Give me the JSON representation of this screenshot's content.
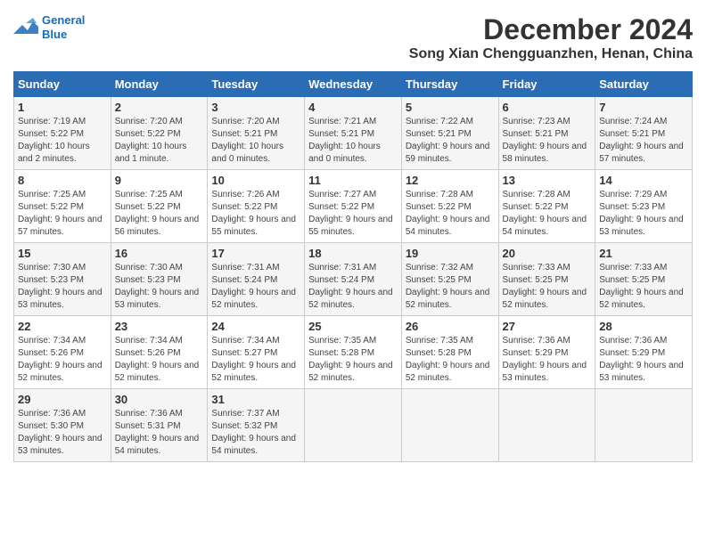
{
  "logo": {
    "line1": "General",
    "line2": "Blue"
  },
  "title": "December 2024",
  "subtitle": "Song Xian Chengguanzhen, Henan, China",
  "weekdays": [
    "Sunday",
    "Monday",
    "Tuesday",
    "Wednesday",
    "Thursday",
    "Friday",
    "Saturday"
  ],
  "weeks": [
    [
      {
        "day": "1",
        "rise": "Sunrise: 7:19 AM",
        "set": "Sunset: 5:22 PM",
        "daylight": "Daylight: 10 hours and 2 minutes."
      },
      {
        "day": "2",
        "rise": "Sunrise: 7:20 AM",
        "set": "Sunset: 5:22 PM",
        "daylight": "Daylight: 10 hours and 1 minute."
      },
      {
        "day": "3",
        "rise": "Sunrise: 7:20 AM",
        "set": "Sunset: 5:21 PM",
        "daylight": "Daylight: 10 hours and 0 minutes."
      },
      {
        "day": "4",
        "rise": "Sunrise: 7:21 AM",
        "set": "Sunset: 5:21 PM",
        "daylight": "Daylight: 10 hours and 0 minutes."
      },
      {
        "day": "5",
        "rise": "Sunrise: 7:22 AM",
        "set": "Sunset: 5:21 PM",
        "daylight": "Daylight: 9 hours and 59 minutes."
      },
      {
        "day": "6",
        "rise": "Sunrise: 7:23 AM",
        "set": "Sunset: 5:21 PM",
        "daylight": "Daylight: 9 hours and 58 minutes."
      },
      {
        "day": "7",
        "rise": "Sunrise: 7:24 AM",
        "set": "Sunset: 5:21 PM",
        "daylight": "Daylight: 9 hours and 57 minutes."
      }
    ],
    [
      {
        "day": "8",
        "rise": "Sunrise: 7:25 AM",
        "set": "Sunset: 5:22 PM",
        "daylight": "Daylight: 9 hours and 57 minutes."
      },
      {
        "day": "9",
        "rise": "Sunrise: 7:25 AM",
        "set": "Sunset: 5:22 PM",
        "daylight": "Daylight: 9 hours and 56 minutes."
      },
      {
        "day": "10",
        "rise": "Sunrise: 7:26 AM",
        "set": "Sunset: 5:22 PM",
        "daylight": "Daylight: 9 hours and 55 minutes."
      },
      {
        "day": "11",
        "rise": "Sunrise: 7:27 AM",
        "set": "Sunset: 5:22 PM",
        "daylight": "Daylight: 9 hours and 55 minutes."
      },
      {
        "day": "12",
        "rise": "Sunrise: 7:28 AM",
        "set": "Sunset: 5:22 PM",
        "daylight": "Daylight: 9 hours and 54 minutes."
      },
      {
        "day": "13",
        "rise": "Sunrise: 7:28 AM",
        "set": "Sunset: 5:22 PM",
        "daylight": "Daylight: 9 hours and 54 minutes."
      },
      {
        "day": "14",
        "rise": "Sunrise: 7:29 AM",
        "set": "Sunset: 5:23 PM",
        "daylight": "Daylight: 9 hours and 53 minutes."
      }
    ],
    [
      {
        "day": "15",
        "rise": "Sunrise: 7:30 AM",
        "set": "Sunset: 5:23 PM",
        "daylight": "Daylight: 9 hours and 53 minutes."
      },
      {
        "day": "16",
        "rise": "Sunrise: 7:30 AM",
        "set": "Sunset: 5:23 PM",
        "daylight": "Daylight: 9 hours and 53 minutes."
      },
      {
        "day": "17",
        "rise": "Sunrise: 7:31 AM",
        "set": "Sunset: 5:24 PM",
        "daylight": "Daylight: 9 hours and 52 minutes."
      },
      {
        "day": "18",
        "rise": "Sunrise: 7:31 AM",
        "set": "Sunset: 5:24 PM",
        "daylight": "Daylight: 9 hours and 52 minutes."
      },
      {
        "day": "19",
        "rise": "Sunrise: 7:32 AM",
        "set": "Sunset: 5:25 PM",
        "daylight": "Daylight: 9 hours and 52 minutes."
      },
      {
        "day": "20",
        "rise": "Sunrise: 7:33 AM",
        "set": "Sunset: 5:25 PM",
        "daylight": "Daylight: 9 hours and 52 minutes."
      },
      {
        "day": "21",
        "rise": "Sunrise: 7:33 AM",
        "set": "Sunset: 5:25 PM",
        "daylight": "Daylight: 9 hours and 52 minutes."
      }
    ],
    [
      {
        "day": "22",
        "rise": "Sunrise: 7:34 AM",
        "set": "Sunset: 5:26 PM",
        "daylight": "Daylight: 9 hours and 52 minutes."
      },
      {
        "day": "23",
        "rise": "Sunrise: 7:34 AM",
        "set": "Sunset: 5:26 PM",
        "daylight": "Daylight: 9 hours and 52 minutes."
      },
      {
        "day": "24",
        "rise": "Sunrise: 7:34 AM",
        "set": "Sunset: 5:27 PM",
        "daylight": "Daylight: 9 hours and 52 minutes."
      },
      {
        "day": "25",
        "rise": "Sunrise: 7:35 AM",
        "set": "Sunset: 5:28 PM",
        "daylight": "Daylight: 9 hours and 52 minutes."
      },
      {
        "day": "26",
        "rise": "Sunrise: 7:35 AM",
        "set": "Sunset: 5:28 PM",
        "daylight": "Daylight: 9 hours and 52 minutes."
      },
      {
        "day": "27",
        "rise": "Sunrise: 7:36 AM",
        "set": "Sunset: 5:29 PM",
        "daylight": "Daylight: 9 hours and 53 minutes."
      },
      {
        "day": "28",
        "rise": "Sunrise: 7:36 AM",
        "set": "Sunset: 5:29 PM",
        "daylight": "Daylight: 9 hours and 53 minutes."
      }
    ],
    [
      {
        "day": "29",
        "rise": "Sunrise: 7:36 AM",
        "set": "Sunset: 5:30 PM",
        "daylight": "Daylight: 9 hours and 53 minutes."
      },
      {
        "day": "30",
        "rise": "Sunrise: 7:36 AM",
        "set": "Sunset: 5:31 PM",
        "daylight": "Daylight: 9 hours and 54 minutes."
      },
      {
        "day": "31",
        "rise": "Sunrise: 7:37 AM",
        "set": "Sunset: 5:32 PM",
        "daylight": "Daylight: 9 hours and 54 minutes."
      },
      null,
      null,
      null,
      null
    ]
  ]
}
